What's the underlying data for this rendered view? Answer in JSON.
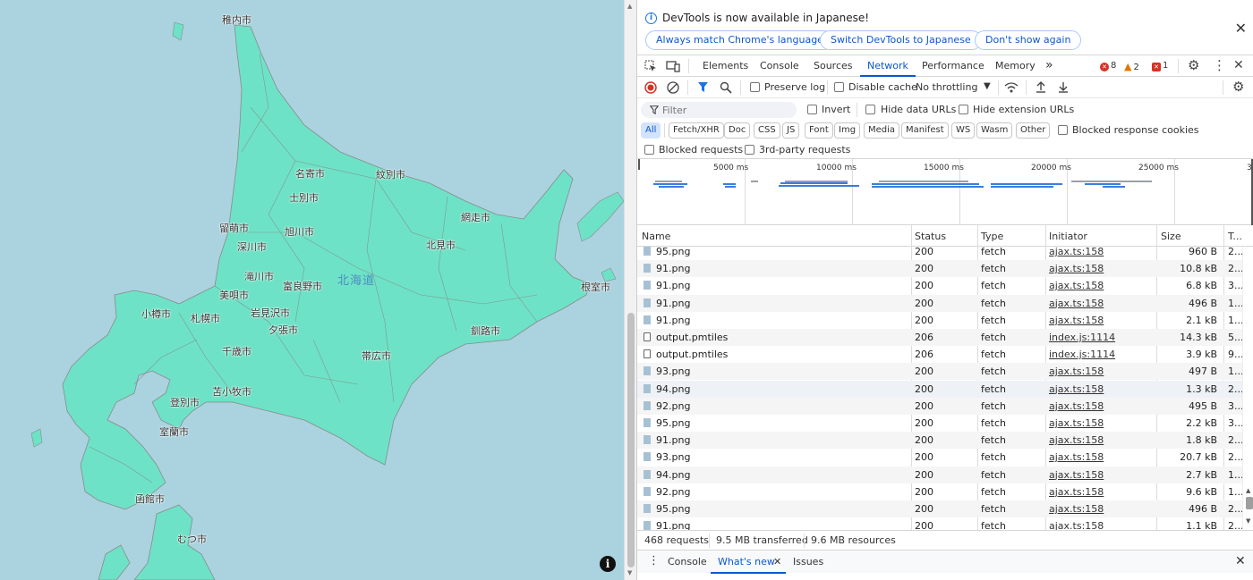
{
  "map": {
    "cities": [
      {
        "id": "wakkanai",
        "label": "稚内市"
      },
      {
        "id": "nayoro",
        "label": "名寄市"
      },
      {
        "id": "shibetsu",
        "label": "士別市"
      },
      {
        "id": "monbetsu",
        "label": "紋別市"
      },
      {
        "id": "abashiri",
        "label": "網走市"
      },
      {
        "id": "kitami",
        "label": "北見市"
      },
      {
        "id": "rumoi",
        "label": "留萌市"
      },
      {
        "id": "fukagawa",
        "label": "深川市"
      },
      {
        "id": "asahikawa",
        "label": "旭川市"
      },
      {
        "id": "takikawa",
        "label": "滝川市"
      },
      {
        "id": "bibai",
        "label": "美唄市"
      },
      {
        "id": "furano",
        "label": "富良野市"
      },
      {
        "id": "hokkaido",
        "label": "北海道"
      },
      {
        "id": "otaru",
        "label": "小樽市"
      },
      {
        "id": "sapporo",
        "label": "札幌市"
      },
      {
        "id": "iwamizawa",
        "label": "岩見沢市"
      },
      {
        "id": "yubari",
        "label": "夕張市"
      },
      {
        "id": "nemuro",
        "label": "根室市"
      },
      {
        "id": "kushiro",
        "label": "釧路市"
      },
      {
        "id": "chitose",
        "label": "千歳市"
      },
      {
        "id": "obihiro",
        "label": "帯広市"
      },
      {
        "id": "tomakomai",
        "label": "苫小牧市"
      },
      {
        "id": "noboribetsu",
        "label": "登別市"
      },
      {
        "id": "muroran",
        "label": "室蘭市"
      },
      {
        "id": "hakodate",
        "label": "函館市"
      },
      {
        "id": "mutsu",
        "label": "むつ市"
      }
    ],
    "info_button": "i"
  },
  "devtools": {
    "infobar": {
      "message": "DevTools is now available in Japanese!",
      "btn_match": "Always match Chrome's language",
      "btn_switch": "Switch DevTools to Japanese",
      "btn_dont_show": "Don't show again",
      "close": "✕"
    },
    "tabs": {
      "elements": "Elements",
      "console": "Console",
      "sources": "Sources",
      "network": "Network",
      "performance": "Performance",
      "memory": "Memory",
      "more": "»"
    },
    "badges": {
      "errors": "8",
      "warnings": "2",
      "issues": "1"
    },
    "toolbar": {
      "preserve_log": "Preserve log",
      "disable_cache": "Disable cache",
      "throttling": "No throttling",
      "filter_placeholder": "Filter",
      "invert": "Invert",
      "hide_data_urls": "Hide data URLs",
      "hide_extension_urls": "Hide extension URLs",
      "blocked_response_cookies": "Blocked response cookies",
      "blocked_requests": "Blocked requests",
      "third_party_requests": "3rd-party requests"
    },
    "type_filters": [
      "All",
      "Fetch/XHR",
      "Doc",
      "CSS",
      "JS",
      "Font",
      "Img",
      "Media",
      "Manifest",
      "WS",
      "Wasm",
      "Other"
    ],
    "overview": {
      "ticks": [
        "5000 ms",
        "10000 ms",
        "15000 ms",
        "20000 ms",
        "25000 ms",
        "3"
      ]
    },
    "columns": {
      "name": "Name",
      "status": "Status",
      "type": "Type",
      "initiator": "Initiator",
      "size": "Size",
      "time": "T..."
    },
    "rows": [
      {
        "name": "95.png",
        "status": "200",
        "type": "fetch",
        "initiator": "ajax.ts:158",
        "size": "960 B",
        "time": "2...",
        "kind": "img"
      },
      {
        "name": "91.png",
        "status": "200",
        "type": "fetch",
        "initiator": "ajax.ts:158",
        "size": "10.8 kB",
        "time": "2...",
        "kind": "img"
      },
      {
        "name": "91.png",
        "status": "200",
        "type": "fetch",
        "initiator": "ajax.ts:158",
        "size": "6.8 kB",
        "time": "3...",
        "kind": "img"
      },
      {
        "name": "91.png",
        "status": "200",
        "type": "fetch",
        "initiator": "ajax.ts:158",
        "size": "496 B",
        "time": "1...",
        "kind": "img"
      },
      {
        "name": "91.png",
        "status": "200",
        "type": "fetch",
        "initiator": "ajax.ts:158",
        "size": "2.1 kB",
        "time": "1...",
        "kind": "img"
      },
      {
        "name": "output.pmtiles",
        "status": "206",
        "type": "fetch",
        "initiator": "index.js:1114",
        "size": "14.3 kB",
        "time": "5...",
        "kind": "doc"
      },
      {
        "name": "output.pmtiles",
        "status": "206",
        "type": "fetch",
        "initiator": "index.js:1114",
        "size": "3.9 kB",
        "time": "9...",
        "kind": "doc"
      },
      {
        "name": "93.png",
        "status": "200",
        "type": "fetch",
        "initiator": "ajax.ts:158",
        "size": "497 B",
        "time": "1...",
        "kind": "img"
      },
      {
        "name": "94.png",
        "status": "200",
        "type": "fetch",
        "initiator": "ajax.ts:158",
        "size": "1.3 kB",
        "time": "2...",
        "kind": "img"
      },
      {
        "name": "92.png",
        "status": "200",
        "type": "fetch",
        "initiator": "ajax.ts:158",
        "size": "495 B",
        "time": "3...",
        "kind": "img"
      },
      {
        "name": "95.png",
        "status": "200",
        "type": "fetch",
        "initiator": "ajax.ts:158",
        "size": "2.2 kB",
        "time": "3...",
        "kind": "img"
      },
      {
        "name": "91.png",
        "status": "200",
        "type": "fetch",
        "initiator": "ajax.ts:158",
        "size": "1.8 kB",
        "time": "2...",
        "kind": "img"
      },
      {
        "name": "93.png",
        "status": "200",
        "type": "fetch",
        "initiator": "ajax.ts:158",
        "size": "20.7 kB",
        "time": "2...",
        "kind": "img"
      },
      {
        "name": "94.png",
        "status": "200",
        "type": "fetch",
        "initiator": "ajax.ts:158",
        "size": "2.7 kB",
        "time": "1...",
        "kind": "img"
      },
      {
        "name": "92.png",
        "status": "200",
        "type": "fetch",
        "initiator": "ajax.ts:158",
        "size": "9.6 kB",
        "time": "1...",
        "kind": "img"
      },
      {
        "name": "95.png",
        "status": "200",
        "type": "fetch",
        "initiator": "ajax.ts:158",
        "size": "496 B",
        "time": "2...",
        "kind": "img"
      },
      {
        "name": "91.png",
        "status": "200",
        "type": "fetch",
        "initiator": "ajax.ts:158",
        "size": "1.1 kB",
        "time": "2...",
        "kind": "img"
      }
    ],
    "status": {
      "requests": "468 requests",
      "transferred": "9.5 MB transferred",
      "resources": "9.6 MB resources"
    },
    "drawer": {
      "menu": "⋮",
      "console": "Console",
      "whats_new": "What's new",
      "issues": "Issues",
      "close": "✕"
    },
    "colors": {
      "accent": "#0b57d0",
      "error": "#d93025",
      "warning": "#e37400",
      "land": "#6ee2c6",
      "sea": "#aad3df"
    }
  }
}
